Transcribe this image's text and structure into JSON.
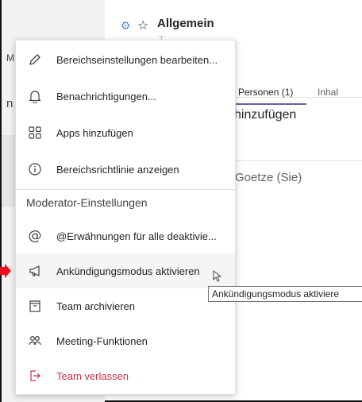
{
  "sidebar": {
    "letter_m": "M",
    "letter_n": "n"
  },
  "header": {
    "channel_name": "Allgemein",
    "subtitle": "T..."
  },
  "tabs": [
    {
      "label": "Personen (1)"
    },
    {
      "label": "Inhal"
    }
  ],
  "main": {
    "add_title": "hinzufügen",
    "member_name": "Goetze (Sie)"
  },
  "menu": {
    "items_top": [
      {
        "label": "Bereichseinstellungen bearbeiten...",
        "icon": "pencil-icon"
      },
      {
        "label": "Benachrichtigungen...",
        "icon": "bell-icon"
      },
      {
        "label": "Apps hinzufügen",
        "icon": "apps-grid-icon"
      },
      {
        "label": "Bereichsrichtlinie anzeigen",
        "icon": "info-icon"
      }
    ],
    "section_header": "Moderator-Einstellungen",
    "items_mod": [
      {
        "label": "@Erwähnungen für alle deaktivie...",
        "icon": "at-icon"
      },
      {
        "label": "Ankündigungsmodus aktivieren",
        "icon": "megaphone-icon"
      },
      {
        "label": "Team archivieren",
        "icon": "archive-icon"
      },
      {
        "label": "Meeting-Funktionen",
        "icon": "people-icon"
      },
      {
        "label": "Team verlassen",
        "icon": "leave-icon"
      }
    ]
  },
  "tooltip": {
    "text": "Ankündigungsmodus aktiviere"
  },
  "colors": {
    "accent": "#6264a7",
    "danger": "#c4314b",
    "arrow": "#e81123"
  }
}
